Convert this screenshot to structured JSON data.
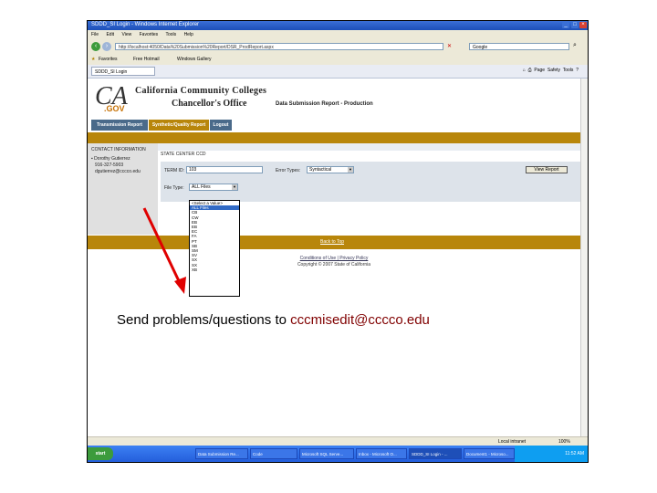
{
  "window": {
    "title": "SDDD_SI Login - Windows Internet Explorer",
    "menu": [
      "File",
      "Edit",
      "View",
      "Favorites",
      "Tools",
      "Help"
    ],
    "address": "http://localhost:4050/Data%20Submission%20Report/DSR_ProdReport.aspx",
    "search_placeholder": "Google",
    "favorites_label": "Favorites",
    "fav_items": [
      "Free Hotmail",
      "Windows Gallery"
    ],
    "tab_label": "SDDD_SI Login",
    "tools": [
      "Page",
      "Safety",
      "Tools"
    ],
    "status": "Local intranet",
    "zoom": "100%"
  },
  "site": {
    "logo_ca": "CA",
    "logo_gov": ".GOV",
    "org_line1": "California Community Colleges",
    "org_line2": "Chancellor's Office",
    "report_title": "Data Submission Report - Production",
    "nav_tabs": [
      "Transmission Report",
      "Synthetic/Quality Report",
      "Logout"
    ],
    "contact": {
      "heading": "CONTACT INFORMATION",
      "name": "Dorothy Gutierrez",
      "phone": "916-327-5903",
      "email": "dgutierrez@cccco.edu"
    },
    "school": "STATE CENTER CCD",
    "form": {
      "term_label": "TERM ID:",
      "term_value": "103",
      "error_types_label": "Error Types:",
      "error_types_value": "Syntactical",
      "file_type_label": "File Type:",
      "file_type_value": "ALL Files",
      "view_button": "View Report"
    },
    "file_type_options": [
      "<Select a Value>",
      "ALL Files",
      "CB",
      "CW",
      "EB",
      "EB",
      "EC",
      "FA",
      "PT",
      "SB",
      "SM",
      "SV",
      "SX",
      "SX",
      "XB"
    ],
    "back_to_top": "Back to Top",
    "footer_links": "Conditions of Use | Privacy Policy",
    "copyright": "Copyright © 2007 State of California"
  },
  "taskbar": {
    "start": "start",
    "tasks": [
      "Data Submission Re...",
      "Code",
      "Microsoft SQL Serve...",
      "Inbox - Microsoft O...",
      "SDDD_SI Login - ...",
      "Document1 - Microso..."
    ],
    "clock": "11:52 AM"
  },
  "caption": {
    "prefix": "Send problems/questions to ",
    "email": "cccmisedit@cccco.edu"
  },
  "colors": {
    "arrow": "#e00000",
    "gold_bar": "#b8860b",
    "email": "#800000"
  }
}
